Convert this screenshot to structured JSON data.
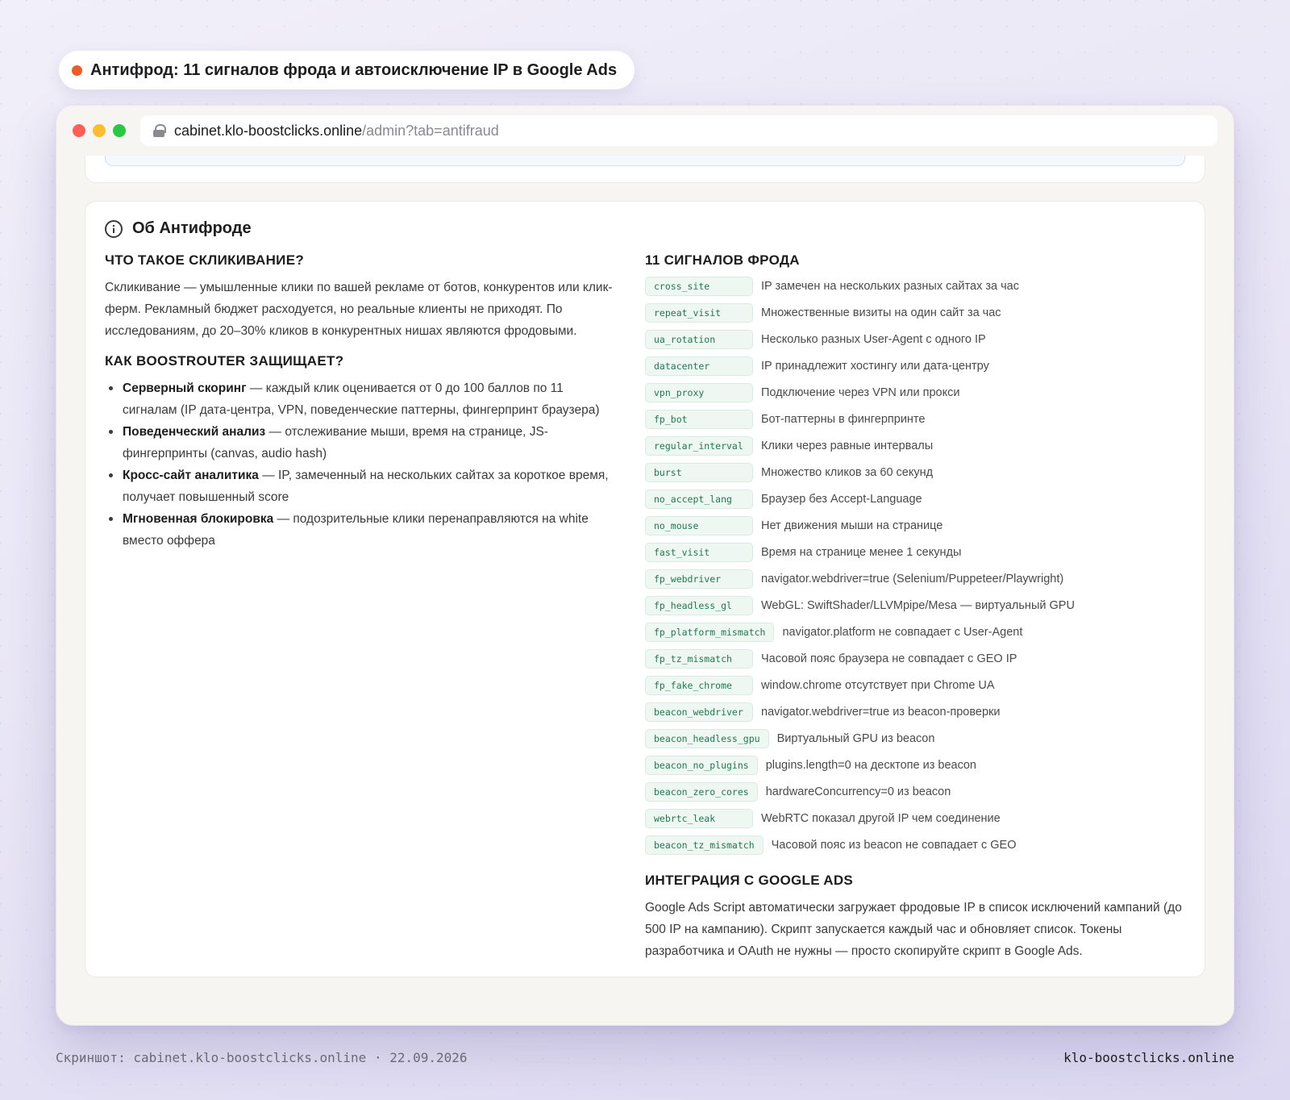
{
  "title_pill": {
    "text": "Антифрод: 11 сигналов фрода и автоисключение IP в Google Ads",
    "dot_color": "#f05a28"
  },
  "browser": {
    "url_host": "cabinet.klo-boostclicks.online",
    "url_path": "/admin?tab=antifraud"
  },
  "card": {
    "title": "Об Антифроде",
    "left": {
      "h1": "ЧТО ТАКОЕ СКЛИКИВАНИЕ?",
      "p1": "Скликивание — умышленные клики по вашей рекламе от ботов, конкурентов или клик-ферм. Рекламный бюджет расходуется, но реальные клиенты не приходят. По исследованиям, до 20–30% кликов в конкурентных нишах являются фродовыми.",
      "h2": "КАК BOOSTROUTER ЗАЩИЩАЕТ?",
      "bullets": [
        {
          "b": "Серверный скоринг",
          "t": " — каждый клик оценивается от 0 до 100 баллов по 11 сигналам (IP дата-центра, VPN, поведенческие паттерны, фингерпринт браузера)"
        },
        {
          "b": "Поведенческий анализ",
          "t": " — отслеживание мыши, время на странице, JS-фингерпринты (canvas, audio hash)"
        },
        {
          "b": "Кросс-сайт аналитика",
          "t": " — IP, замеченный на нескольких сайтах за короткое время, получает повышенный score"
        },
        {
          "b": "Мгновенная блокировка",
          "t": " — подозрительные клики перенаправляются на white вместо оффера"
        }
      ]
    },
    "right": {
      "h1": "11 СИГНАЛОВ ФРОДА",
      "signals": [
        {
          "code": "cross_site",
          "desc": "IP замечен на нескольких разных сайтах за час"
        },
        {
          "code": "repeat_visit",
          "desc": "Множественные визиты на один сайт за час"
        },
        {
          "code": "ua_rotation",
          "desc": "Несколько разных User-Agent с одного IP"
        },
        {
          "code": "datacenter",
          "desc": "IP принадлежит хостингу или дата-центру"
        },
        {
          "code": "vpn_proxy",
          "desc": "Подключение через VPN или прокси"
        },
        {
          "code": "fp_bot",
          "desc": "Бот-паттерны в фингерпринте"
        },
        {
          "code": "regular_interval",
          "desc": "Клики через равные интервалы"
        },
        {
          "code": "burst",
          "desc": "Множество кликов за 60 секунд"
        },
        {
          "code": "no_accept_lang",
          "desc": "Браузер без Accept-Language"
        },
        {
          "code": "no_mouse",
          "desc": "Нет движения мыши на странице"
        },
        {
          "code": "fast_visit",
          "desc": "Время на странице менее 1 секунды"
        },
        {
          "code": "fp_webdriver",
          "desc": "navigator.webdriver=true (Selenium/Puppeteer/Playwright)"
        },
        {
          "code": "fp_headless_gl",
          "desc": "WebGL: SwiftShader/LLVMpipe/Mesa — виртуальный GPU"
        },
        {
          "code": "fp_platform_mismatch",
          "desc": "navigator.platform не совпадает с User-Agent"
        },
        {
          "code": "fp_tz_mismatch",
          "desc": "Часовой пояс браузера не совпадает с GEO IP"
        },
        {
          "code": "fp_fake_chrome",
          "desc": "window.chrome отсутствует при Chrome UA"
        },
        {
          "code": "beacon_webdriver",
          "desc": "navigator.webdriver=true из beacon-проверки"
        },
        {
          "code": "beacon_headless_gpu",
          "desc": "Виртуальный GPU из beacon"
        },
        {
          "code": "beacon_no_plugins",
          "desc": "plugins.length=0 на десктопе из beacon"
        },
        {
          "code": "beacon_zero_cores",
          "desc": "hardwareConcurrency=0 из beacon"
        },
        {
          "code": "webrtc_leak",
          "desc": "WebRTC показал другой IP чем соединение"
        },
        {
          "code": "beacon_tz_mismatch",
          "desc": "Часовой пояс из beacon не совпадает с GEO"
        }
      ],
      "h2": "ИНТЕГРАЦИЯ С GOOGLE ADS",
      "p2": "Google Ads Script автоматически загружает фродовые IP в список исключений кампаний (до 500 IP на кампанию). Скрипт запускается каждый час и обновляет список. Токены разработчика и OAuth не нужны — просто скопируйте скрипт в Google Ads."
    }
  },
  "footer": {
    "left": "Скриншот: cabinet.klo-boostclicks.online · 22.09.2026",
    "right": "klo-boostclicks.online"
  }
}
